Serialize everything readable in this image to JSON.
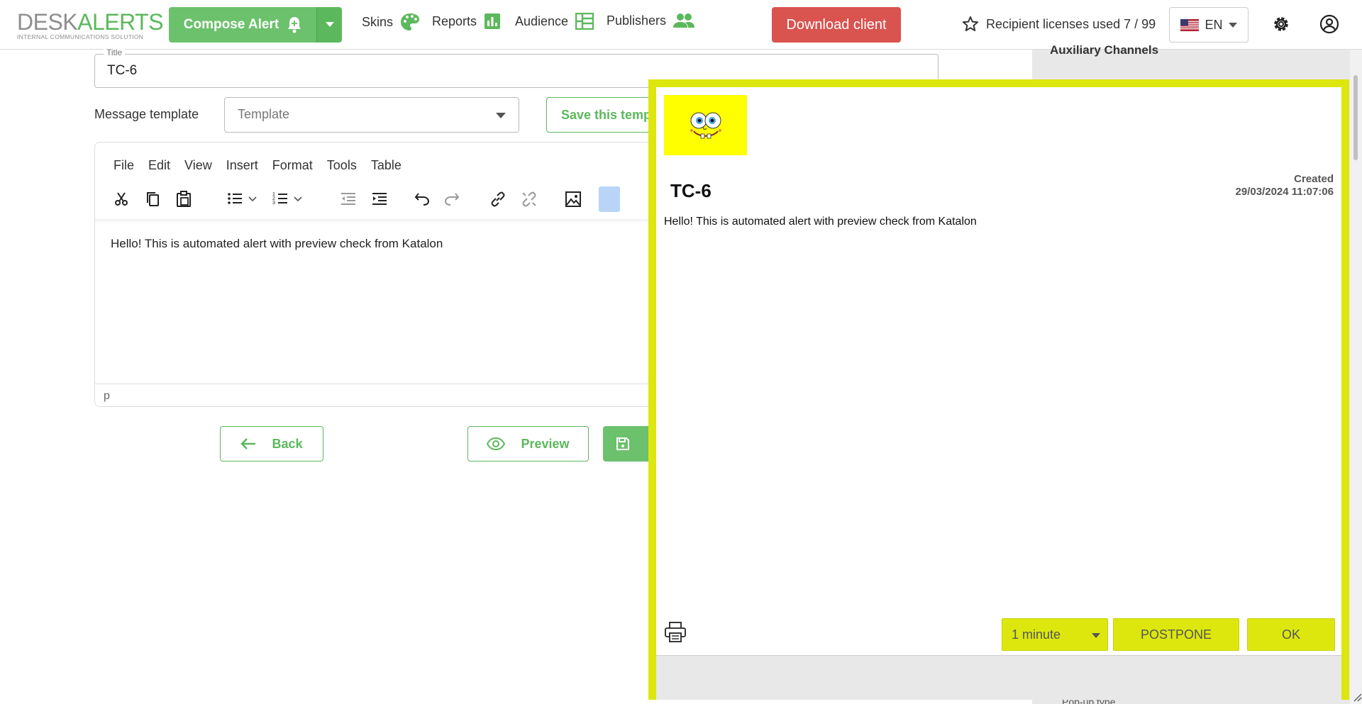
{
  "brand": {
    "logo_part1": "DESK",
    "logo_part2": "ALERTS",
    "tagline": "INTERNAL COMMUNICATIONS SOLUTION"
  },
  "header": {
    "compose_label": "Compose Alert",
    "nav": [
      {
        "label": "Skins",
        "icon": "palette-icon"
      },
      {
        "label": "Reports",
        "icon": "bar-chart-icon"
      },
      {
        "label": "Audience",
        "icon": "table-icon"
      },
      {
        "label": "Publishers",
        "icon": "people-icon"
      }
    ],
    "download_label": "Download client",
    "licenses_text": "Recipient licenses used 7 / 99",
    "language": "EN"
  },
  "sidebar_right": {
    "heading": "Auxiliary Channels",
    "popup_type_label": "Pop-up type"
  },
  "form": {
    "title_legend": "Title",
    "title_value": "TC-6",
    "template_label": "Message template",
    "template_placeholder": "Template",
    "save_template_label": "Save this template"
  },
  "editor": {
    "menu": [
      "File",
      "Edit",
      "View",
      "Insert",
      "Format",
      "Tools",
      "Table"
    ],
    "content": "Hello! This is automated alert with preview check from Katalon",
    "status_path": "p"
  },
  "actions": {
    "back_label": "Back",
    "preview_label": "Preview"
  },
  "preview_popup": {
    "title": "TC-6",
    "created_label": "Created",
    "created_date": "29/03/2024 11:07:06",
    "body": "Hello! This is automated alert with preview check from Katalon",
    "postpone_interval": "1 minute",
    "postpone_label": "POSTPONE",
    "ok_label": "OK"
  },
  "colors": {
    "brand_green": "#5cb85c",
    "download_red": "#d9534f",
    "skin_yellow": "#dde70d",
    "logo_yellow": "#ffff00"
  }
}
